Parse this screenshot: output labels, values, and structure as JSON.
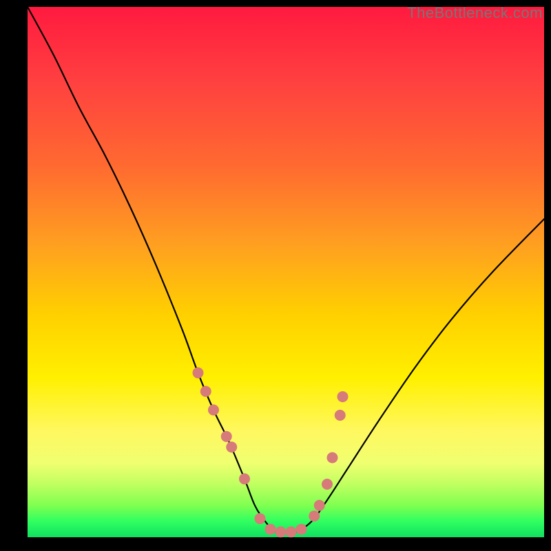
{
  "watermark": "TheBottleneck.com",
  "chart_data": {
    "type": "line",
    "title": "",
    "xlabel": "",
    "ylabel": "",
    "xlim": [
      0,
      100
    ],
    "ylim": [
      0,
      100
    ],
    "grid": false,
    "legend": false,
    "background_gradient": {
      "direction": "top-to-bottom",
      "stops": [
        {
          "pct": 0,
          "color": "#ff1a3f"
        },
        {
          "pct": 30,
          "color": "#ff6a30"
        },
        {
          "pct": 58,
          "color": "#ffd000"
        },
        {
          "pct": 80,
          "color": "#fff860"
        },
        {
          "pct": 94,
          "color": "#7fff50"
        },
        {
          "pct": 100,
          "color": "#10e060"
        }
      ]
    },
    "series": [
      {
        "name": "bottleneck-curve",
        "x": [
          0,
          5,
          10,
          15,
          20,
          25,
          30,
          33,
          36,
          39,
          42,
          44,
          46,
          48,
          50,
          52,
          55,
          58,
          62,
          68,
          75,
          82,
          90,
          100
        ],
        "y": [
          100,
          91,
          81,
          72,
          62,
          51,
          39,
          31,
          24,
          18,
          11,
          6,
          3,
          1,
          1,
          1,
          3,
          7,
          13,
          22,
          32,
          41,
          50,
          60
        ]
      }
    ],
    "markers": {
      "name": "highlight-points",
      "color": "#d77a7a",
      "radius_px": 8,
      "x": [
        33.0,
        34.5,
        36.0,
        38.5,
        39.5,
        42.0,
        45.0,
        47.0,
        49.0,
        51.0,
        53.0,
        55.5,
        56.5,
        58.0,
        59.0,
        60.5,
        61.0
      ],
      "y": [
        31.0,
        27.5,
        24.0,
        19.0,
        17.0,
        11.0,
        3.5,
        1.5,
        1.0,
        1.0,
        1.5,
        4.0,
        6.0,
        10.0,
        15.0,
        23.0,
        26.5
      ]
    }
  }
}
